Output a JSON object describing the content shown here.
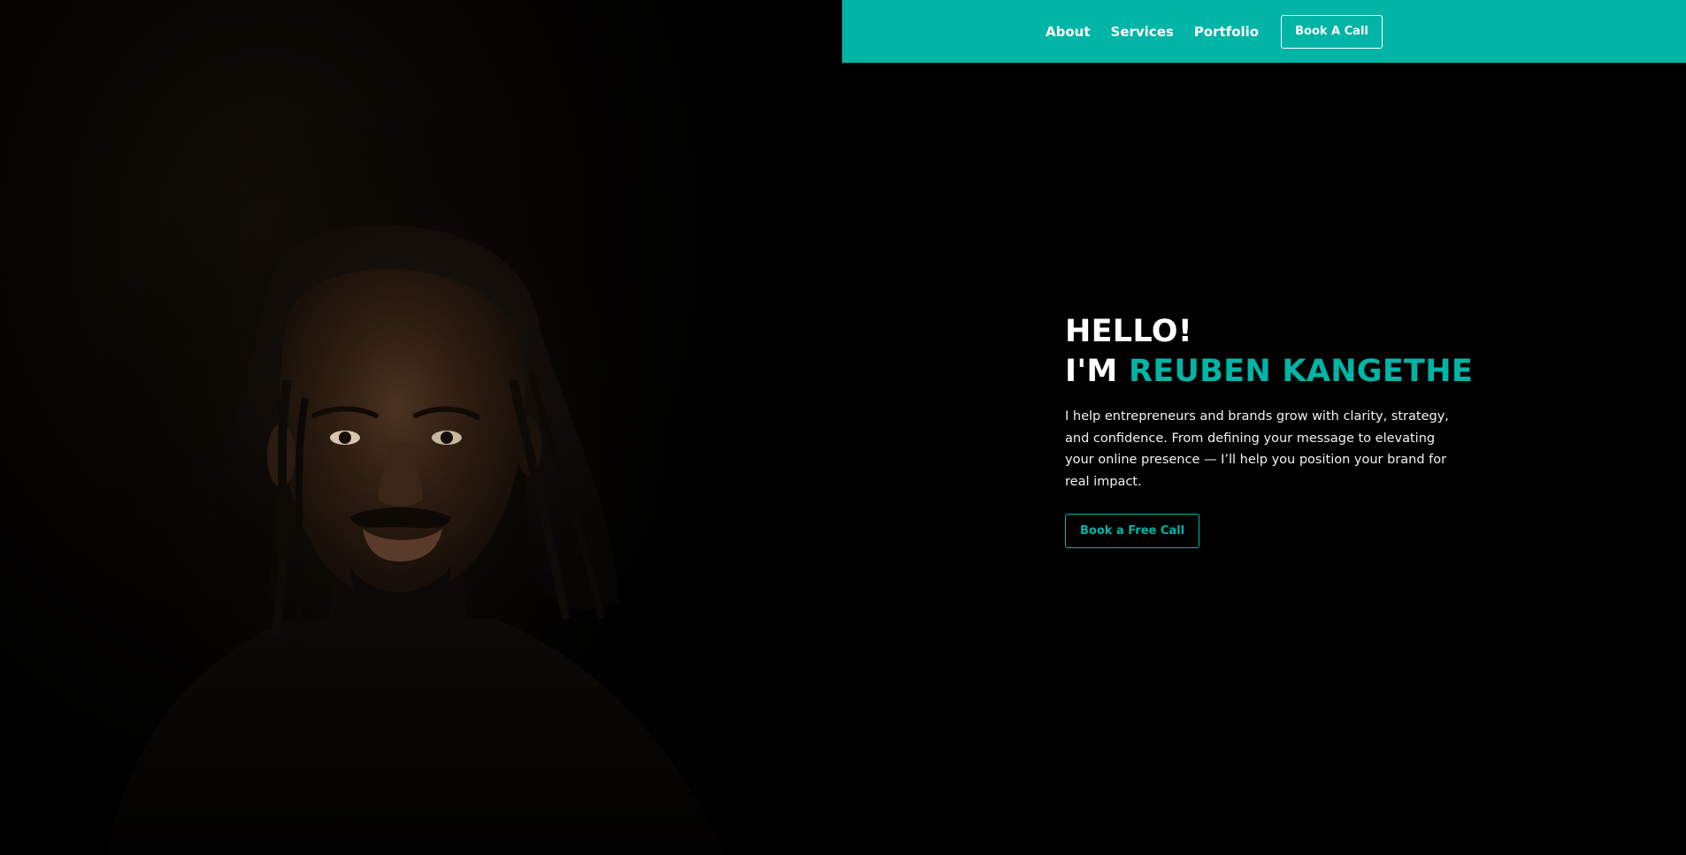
{
  "nav": {
    "links": [
      {
        "label": "About"
      },
      {
        "label": "Services"
      },
      {
        "label": "Portfolio"
      }
    ],
    "cta_label": "Book A Call"
  },
  "hero": {
    "greeting": "HELLO!",
    "intro_prefix": "I'M",
    "name": "REUBEN KANGETHE",
    "description": "I help entrepreneurs and brands grow with clarity, strategy, and confidence. From defining your message to elevating your online presence — I’ll help you position your brand for real impact.",
    "cta_label": "Book a Free Call"
  },
  "photo": {
    "icon": "portrait-photo"
  },
  "colors": {
    "accent": "#00b4a6",
    "background": "#000000",
    "text": "#ffffff"
  }
}
